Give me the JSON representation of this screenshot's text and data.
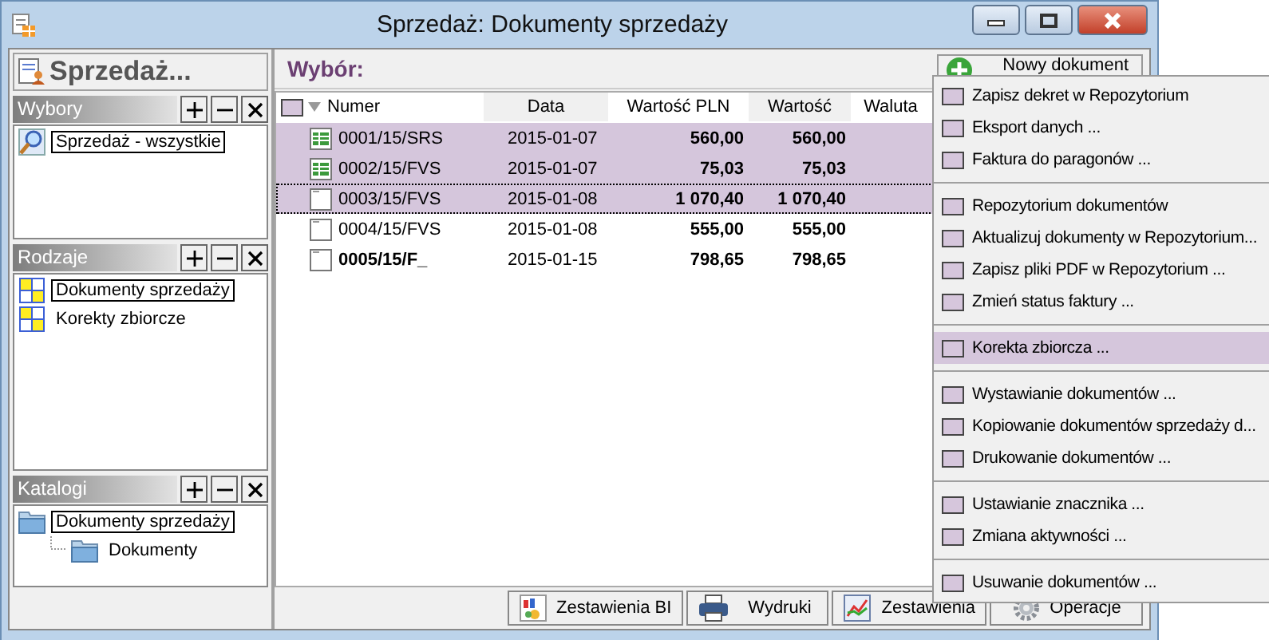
{
  "window": {
    "title": "Sprzedaż: Dokumenty sprzedaży"
  },
  "sidebar": {
    "title": "Sprzedaż...",
    "sections": [
      {
        "title": "Wybory",
        "kind": "search",
        "items": [
          {
            "label": "Sprzedaż - wszystkie",
            "selected": true
          }
        ]
      },
      {
        "title": "Rodzaje",
        "kind": "grid",
        "items": [
          {
            "label": "Dokumenty sprzedaży",
            "selected": true
          },
          {
            "label": "Korekty zbiorcze",
            "selected": false
          }
        ]
      },
      {
        "title": "Katalogi",
        "kind": "folder",
        "items": [
          {
            "label": "Dokumenty sprzedaży",
            "selected": true,
            "children": [
              {
                "label": "Dokumenty",
                "selected": false
              }
            ]
          }
        ]
      }
    ]
  },
  "header": {
    "title": "Wybór:",
    "new_button": "Nowy dokument"
  },
  "table": {
    "select_all": {
      "checked": false
    },
    "columns": [
      "Numer",
      "Data",
      "Wartość PLN",
      "Wartość",
      "Waluta"
    ],
    "rows": [
      {
        "kind": "green",
        "number": "0001/15/SRS",
        "date": "2015-01-07",
        "value_pln": "560,00",
        "value": "560,00",
        "selected": true,
        "focused": false,
        "bold": false
      },
      {
        "kind": "green",
        "number": "0002/15/FVS",
        "date": "2015-01-07",
        "value_pln": "75,03",
        "value": "75,03",
        "selected": true,
        "focused": false,
        "bold": false
      },
      {
        "kind": "blank",
        "number": "0003/15/FVS",
        "date": "2015-01-08",
        "value_pln": "1 070,40",
        "value": "1 070,40",
        "selected": true,
        "focused": true,
        "bold": false
      },
      {
        "kind": "blank",
        "number": "0004/15/FVS",
        "date": "2015-01-08",
        "value_pln": "555,00",
        "value": "555,00",
        "selected": false,
        "focused": false,
        "bold": false
      },
      {
        "kind": "blank",
        "number": "0005/15/F_",
        "date": "2015-01-15",
        "value_pln": "798,65",
        "value": "798,65",
        "selected": false,
        "focused": false,
        "bold": true
      }
    ]
  },
  "bottom_buttons": [
    {
      "label": "Zestawienia BI",
      "kind": "bi"
    },
    {
      "label": "Wydruki",
      "kind": "print"
    },
    {
      "label": "Zestawienia",
      "kind": "chart"
    },
    {
      "label": "Operacje",
      "kind": "gear"
    }
  ],
  "menu": [
    {
      "kind": "item",
      "label": "Zapisz dekret w Repozytorium",
      "selected": false
    },
    {
      "kind": "item",
      "label": "Eksport danych ...",
      "selected": false
    },
    {
      "kind": "item",
      "label": "Faktura do paragonów ...",
      "selected": false
    },
    {
      "kind": "separator"
    },
    {
      "kind": "item",
      "label": "Repozytorium dokumentów",
      "selected": false
    },
    {
      "kind": "item",
      "label": "Aktualizuj dokumenty w Repozytorium...",
      "selected": false
    },
    {
      "kind": "item",
      "label": "Zapisz pliki PDF w Repozytorium ...",
      "selected": false
    },
    {
      "kind": "item",
      "label": "Zmień status faktury ...",
      "selected": false
    },
    {
      "kind": "separator"
    },
    {
      "kind": "item",
      "label": "Korekta zbiorcza ...",
      "selected": true
    },
    {
      "kind": "separator"
    },
    {
      "kind": "item",
      "label": "Wystawianie dokumentów ...",
      "selected": false
    },
    {
      "kind": "item",
      "label": "Kopiowanie dokumentów sprzedaży d...",
      "selected": false
    },
    {
      "kind": "item",
      "label": "Drukowanie dokumentów ...",
      "selected": false
    },
    {
      "kind": "separator"
    },
    {
      "kind": "item",
      "label": "Ustawianie znacznika ...",
      "selected": false
    },
    {
      "kind": "item",
      "label": "Zmiana aktywności ...",
      "selected": false
    },
    {
      "kind": "separator"
    },
    {
      "kind": "item",
      "label": "Usuwanie dokumentów ...",
      "selected": false
    }
  ]
}
